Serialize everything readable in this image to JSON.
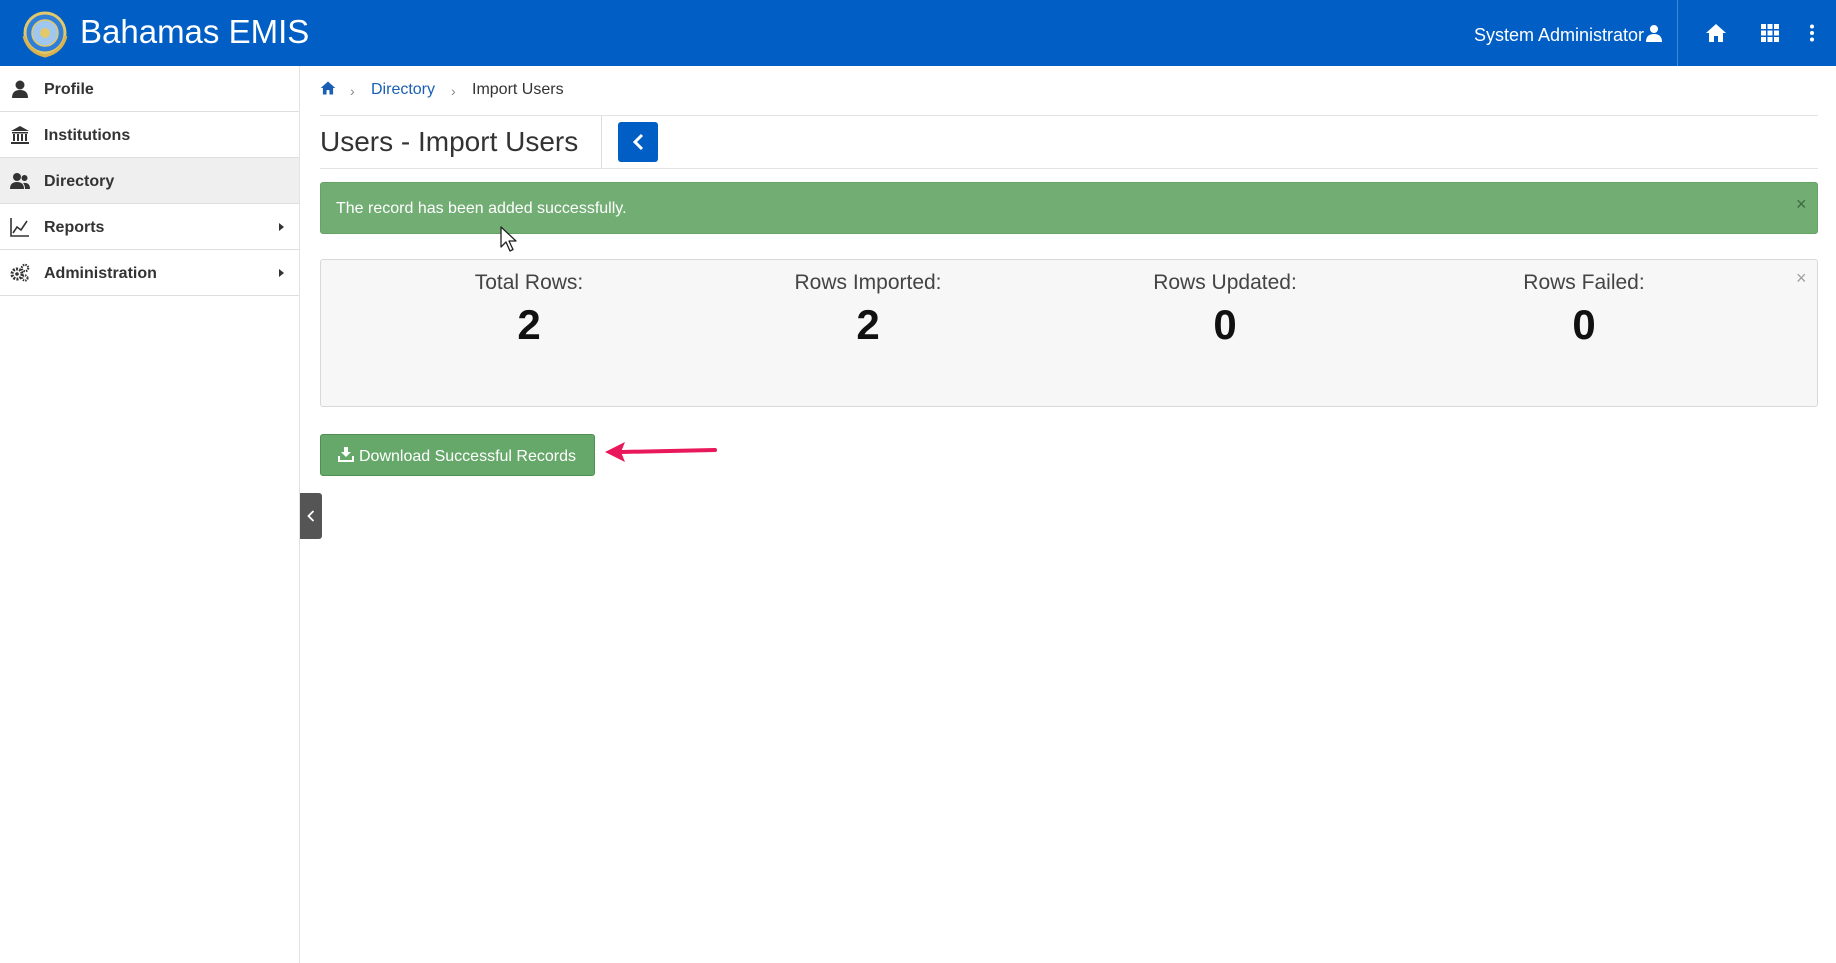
{
  "app": {
    "title": "Bahamas EMIS",
    "brand_color": "#005ec5",
    "logo_icon": "coat-of-arms-logo"
  },
  "header": {
    "user_name": "System Administrator",
    "icons": [
      "user-icon",
      "home-icon",
      "apps-grid-icon",
      "more-vertical-icon"
    ]
  },
  "sidebar": {
    "items": [
      {
        "label": "Profile",
        "icon": "user-icon",
        "has_submenu": false,
        "active": false
      },
      {
        "label": "Institutions",
        "icon": "institution-icon",
        "has_submenu": false,
        "active": false
      },
      {
        "label": "Directory",
        "icon": "users-icon",
        "has_submenu": false,
        "active": true
      },
      {
        "label": "Reports",
        "icon": "line-chart-icon",
        "has_submenu": true,
        "active": false
      },
      {
        "label": "Administration",
        "icon": "gears-icon",
        "has_submenu": true,
        "active": false
      }
    ]
  },
  "breadcrumb": {
    "home_icon": "home-icon",
    "items": [
      "Directory",
      "Import Users"
    ]
  },
  "page": {
    "title": "Users - Import Users",
    "back_icon": "chevron-left-icon"
  },
  "alert": {
    "message": "The record has been added successfully.",
    "close": "×",
    "color": "#72ad74"
  },
  "summary": {
    "close": "×",
    "stats": [
      {
        "label": "Total Rows:",
        "value": "2"
      },
      {
        "label": "Rows Imported:",
        "value": "2"
      },
      {
        "label": "Rows Updated:",
        "value": "0"
      },
      {
        "label": "Rows Failed:",
        "value": "0"
      }
    ]
  },
  "actions": {
    "download_label": "Download Successful Records",
    "download_icon": "download-icon",
    "annotation_arrow_color": "#e8185a"
  }
}
